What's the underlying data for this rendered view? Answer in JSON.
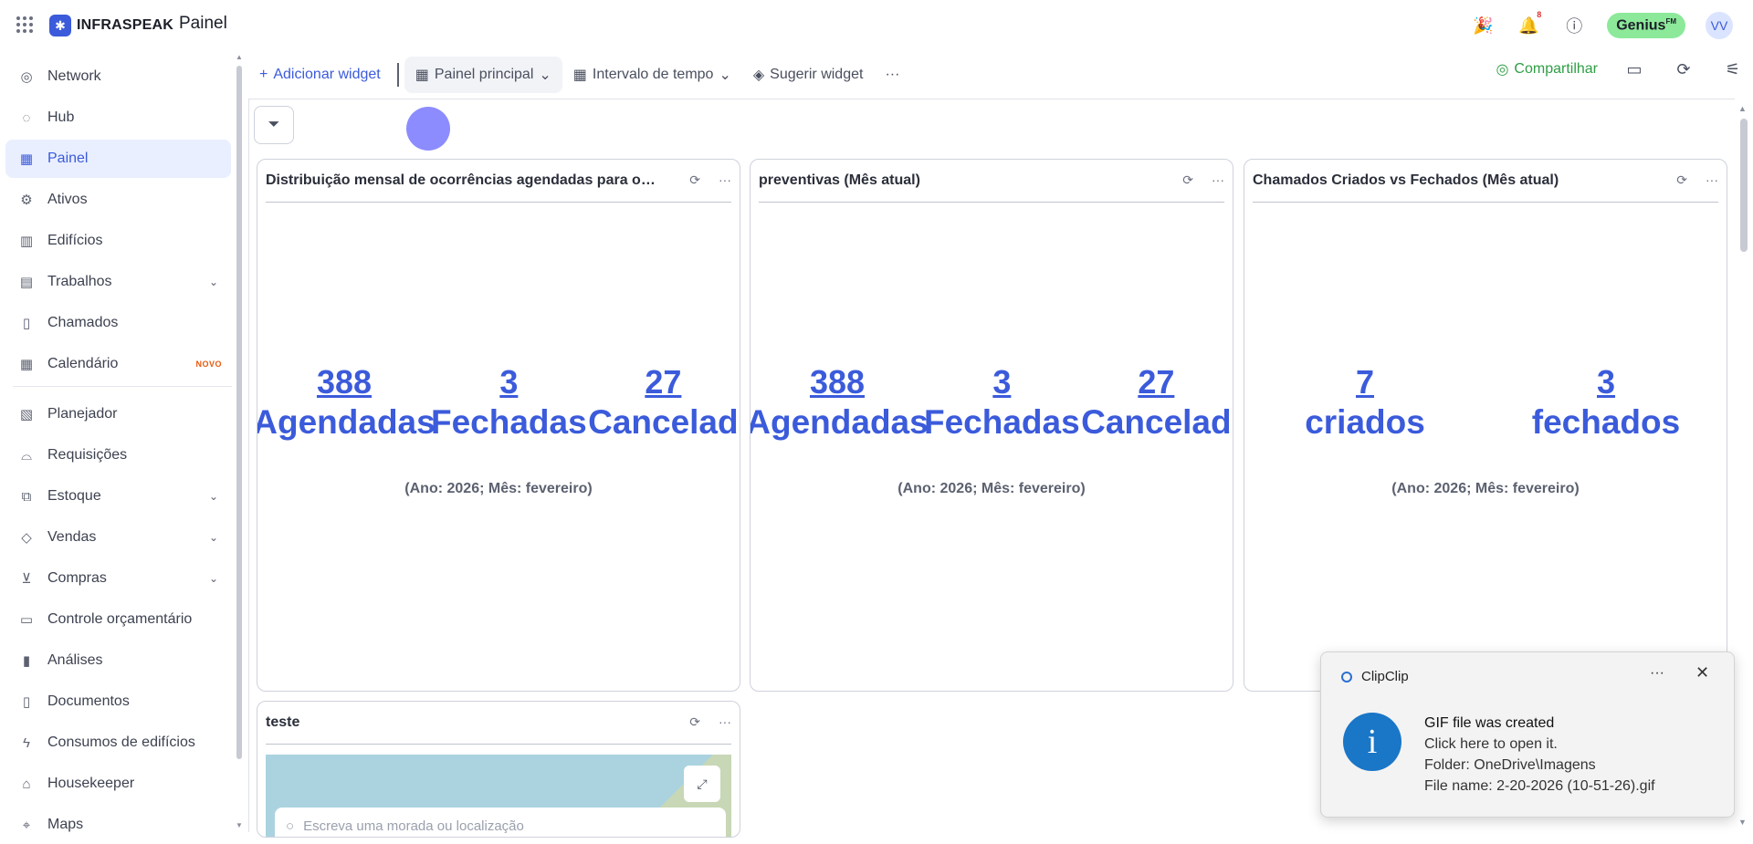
{
  "header": {
    "brand": "INFRASPEAK",
    "page_title": "Painel",
    "notifications_count": "8",
    "genius_label": "Genius",
    "genius_suffix": "FM",
    "avatar_initials": "VV"
  },
  "sidebar": {
    "items": [
      {
        "label": "Network",
        "icon": "globe-icon"
      },
      {
        "label": "Hub",
        "icon": "hub-icon"
      },
      {
        "label": "Painel",
        "icon": "dashboard-icon",
        "active": true
      },
      {
        "label": "Ativos",
        "icon": "assets-icon"
      },
      {
        "label": "Edifícios",
        "icon": "building-icon"
      },
      {
        "label": "Trabalhos",
        "icon": "calendar-check-icon",
        "expandable": true
      },
      {
        "label": "Chamados",
        "icon": "clipboard-icon"
      },
      {
        "label": "Calendário",
        "icon": "calendar-icon",
        "badge": "NOVO"
      },
      {
        "label": "Planejador",
        "icon": "planner-icon"
      },
      {
        "label": "Requisições",
        "icon": "bell-service-icon"
      },
      {
        "label": "Estoque",
        "icon": "stock-icon",
        "expandable": true
      },
      {
        "label": "Vendas",
        "icon": "tag-icon",
        "expandable": true
      },
      {
        "label": "Compras",
        "icon": "cart-icon",
        "expandable": true
      },
      {
        "label": "Controle orçamentário",
        "icon": "wallet-icon"
      },
      {
        "label": "Análises",
        "icon": "chart-bars-icon"
      },
      {
        "label": "Documentos",
        "icon": "document-icon"
      },
      {
        "label": "Consumos de edifícios",
        "icon": "bolt-icon"
      },
      {
        "label": "Housekeeper",
        "icon": "broom-icon"
      },
      {
        "label": "Maps",
        "icon": "map-pin-icon"
      }
    ]
  },
  "toolbar": {
    "add_widget": "Adicionar widget",
    "dashboard_select": "Painel principal",
    "time_range": "Intervalo de tempo",
    "suggest_widget": "Sugerir widget",
    "more": "···",
    "share": "Compartilhar"
  },
  "widgets": [
    {
      "title": "Distribuição mensal de ocorrências agendadas para o i...",
      "kpis": [
        {
          "value": "388",
          "label": "Agendadas"
        },
        {
          "value": "3",
          "label": "Fechadas"
        },
        {
          "value": "27",
          "label": "Cancelad"
        }
      ],
      "subtitle": "(Ano: 2026; Mês: fevereiro)"
    },
    {
      "title": "preventivas (Mês atual)",
      "kpis": [
        {
          "value": "388",
          "label": "Agendadas"
        },
        {
          "value": "3",
          "label": "Fechadas"
        },
        {
          "value": "27",
          "label": "Cancelad"
        }
      ],
      "subtitle": "(Ano: 2026; Mês: fevereiro)"
    },
    {
      "title": "Chamados Criados vs Fechados (Mês atual)",
      "kpis": [
        {
          "value": "7",
          "label": "criados"
        },
        {
          "value": "3",
          "label": "fechados"
        }
      ],
      "subtitle": "(Ano: 2026; Mês: fevereiro)"
    },
    {
      "title": "teste",
      "map_search_placeholder": "Escreva uma morada ou localização"
    }
  ],
  "toast": {
    "app_name": "ClipClip",
    "more": "···",
    "close": "✕",
    "line1": "GIF file was created",
    "line2": "Click here to open it.",
    "line3": "Folder: OneDrive\\Imagens",
    "line4": "File name: 2-20-2026 (10-51-26).gif"
  },
  "colors": {
    "accent": "#3b5bdb",
    "share": "#2f9e44",
    "genius": "#8ce99a",
    "notification": "#e03131"
  }
}
